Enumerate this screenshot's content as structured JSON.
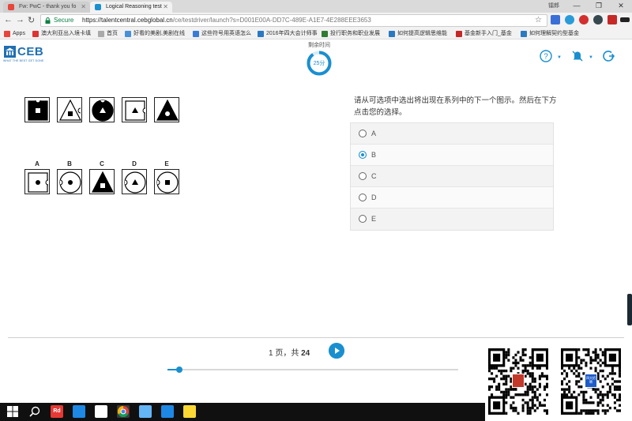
{
  "browser": {
    "tabs": [
      {
        "title": "Fw: PwC - thank you fo",
        "active": false
      },
      {
        "title": "Logical Reasoning test",
        "active": true
      }
    ],
    "user_name": "镭郎",
    "secure_label": "Secure",
    "url_host": "https://talentcentral.cebglobal.cn",
    "url_rest": "/ce/testdriver/launch?s=D001E00A-DD7C-489E-A1E7-4E288EEE3653",
    "bookmarks": [
      {
        "label": "Apps",
        "color": "#e8453c"
      },
      {
        "label": "澳大利亚出入境卡填",
        "color": "#d33"
      },
      {
        "label": "首页",
        "color": "#888"
      },
      {
        "label": "好看的美剧,美剧在线",
        "color": "#4a90d9"
      },
      {
        "label": "这些符号用英语怎么",
        "color": "#3a7bd5"
      },
      {
        "label": "2016年四大会计师事",
        "color": "#2b79c2"
      },
      {
        "label": "投行职务和职业发展",
        "color": "#2e7d32"
      },
      {
        "label": "如何提高逻辑思维能",
        "color": "#2b79c2"
      },
      {
        "label": "基金新手入门_基金",
        "color": "#c62828"
      },
      {
        "label": "如何理解契约型基金",
        "color": "#2b79c2"
      }
    ]
  },
  "app": {
    "logo_text": "CEB",
    "logo_tagline": "WHAT THE BEST GET DONE",
    "timer_label": "剩余时间",
    "timer_value": "25分",
    "timer_fraction_remaining": 0.9,
    "colors": {
      "accent": "#1a8fd0",
      "brand": "#1f6fb2"
    }
  },
  "header_icons": [
    "help-icon",
    "mute-icon",
    "exit-icon"
  ],
  "puzzle": {
    "sequence": [
      {
        "shape": "square",
        "fill": "black",
        "marker": "square",
        "marker_fill": "white",
        "notches": [
          "top"
        ]
      },
      {
        "shape": "triangle",
        "fill": "white",
        "marker": "square",
        "marker_fill": "black",
        "notches": [
          "right"
        ]
      },
      {
        "shape": "circle",
        "fill": "black",
        "marker": "triangle",
        "marker_fill": "white",
        "notches": [
          "top"
        ]
      },
      {
        "shape": "square",
        "fill": "white",
        "marker": "triangle",
        "marker_fill": "black",
        "notches": [
          "right"
        ]
      },
      {
        "shape": "triangle",
        "fill": "black",
        "marker": "circle",
        "marker_fill": "white",
        "notches": []
      }
    ],
    "options": [
      {
        "label": "A",
        "shape": "square",
        "fill": "white",
        "marker": "circle",
        "marker_fill": "black",
        "notches": [
          "right"
        ]
      },
      {
        "label": "B",
        "shape": "circle",
        "fill": "white",
        "marker": "circle",
        "marker_fill": "black",
        "notches": [
          "left"
        ]
      },
      {
        "label": "C",
        "shape": "triangle",
        "fill": "black",
        "marker": "square",
        "marker_fill": "white",
        "notches": []
      },
      {
        "label": "D",
        "shape": "circle",
        "fill": "white",
        "marker": "triangle",
        "marker_fill": "black",
        "notches": [
          "left"
        ]
      },
      {
        "label": "E",
        "shape": "circle",
        "fill": "white",
        "marker": "square",
        "marker_fill": "black",
        "notches": [
          "left"
        ]
      }
    ]
  },
  "question": {
    "text": "请从可选项中选出将出现在系列中的下一个图示。然后在下方点击您的选择。",
    "answers": [
      "A",
      "B",
      "C",
      "D",
      "E"
    ],
    "selected": "B"
  },
  "pager": {
    "prefix": "1",
    "middle": "页，共",
    "total": "24"
  },
  "progress": {
    "fraction": 0.04
  },
  "qr": [
    {
      "badge": "",
      "badge_color": "#c0392b"
    },
    {
      "badge": "四大招聘",
      "badge_color": "#1e5cc8"
    }
  ],
  "taskbar": {
    "icons": [
      {
        "name": "start-icon",
        "color": "#ffffff"
      },
      {
        "name": "search-icon",
        "color": "#ffffff"
      },
      {
        "name": "app-icon",
        "color": "#e53935"
      },
      {
        "name": "edge-icon",
        "color": "#1e88e5"
      },
      {
        "name": "store-icon",
        "color": "#ffffff"
      },
      {
        "name": "chrome-icon",
        "color": "#fbc02d"
      },
      {
        "name": "bird-icon",
        "color": "#64b5f6"
      },
      {
        "name": "k-icon",
        "color": "#1e88e5"
      },
      {
        "name": "photos-icon",
        "color": "#fdd835"
      }
    ],
    "active_app": "chrome-icon",
    "app_badge": "Rd"
  }
}
